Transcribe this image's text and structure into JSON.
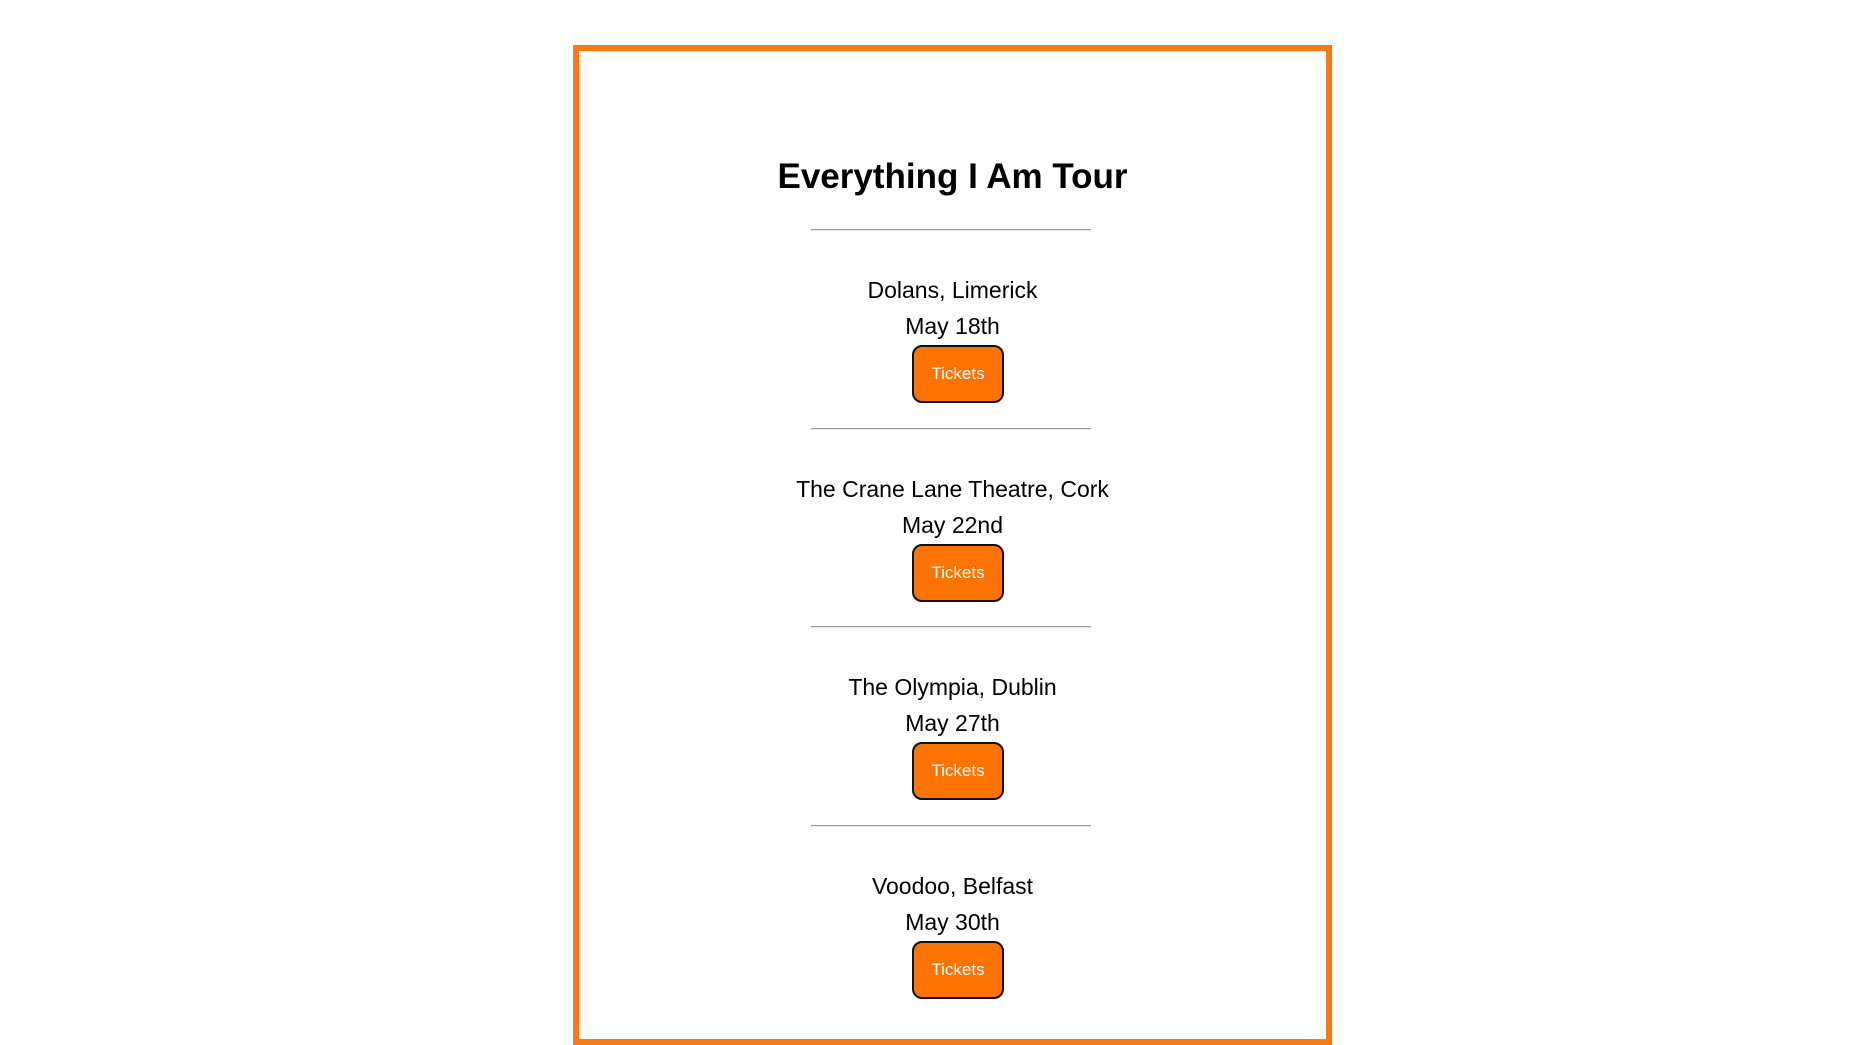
{
  "page": {
    "title": "Everything I Am Tour"
  },
  "colors": {
    "accent": "#f97a0e",
    "button_bg": "#ff7300",
    "button_text": "#ffffff",
    "text": "#000000"
  },
  "events": [
    {
      "venue": "Dolans, Limerick",
      "date": "May 18th",
      "button_label": "Tickets"
    },
    {
      "venue": "The Crane Lane Theatre, Cork",
      "date": "May 22nd",
      "button_label": "Tickets"
    },
    {
      "venue": "The Olympia, Dublin",
      "date": "May 27th",
      "button_label": "Tickets"
    },
    {
      "venue": "Voodoo, Belfast",
      "date": "May 30th",
      "button_label": "Tickets"
    }
  ]
}
